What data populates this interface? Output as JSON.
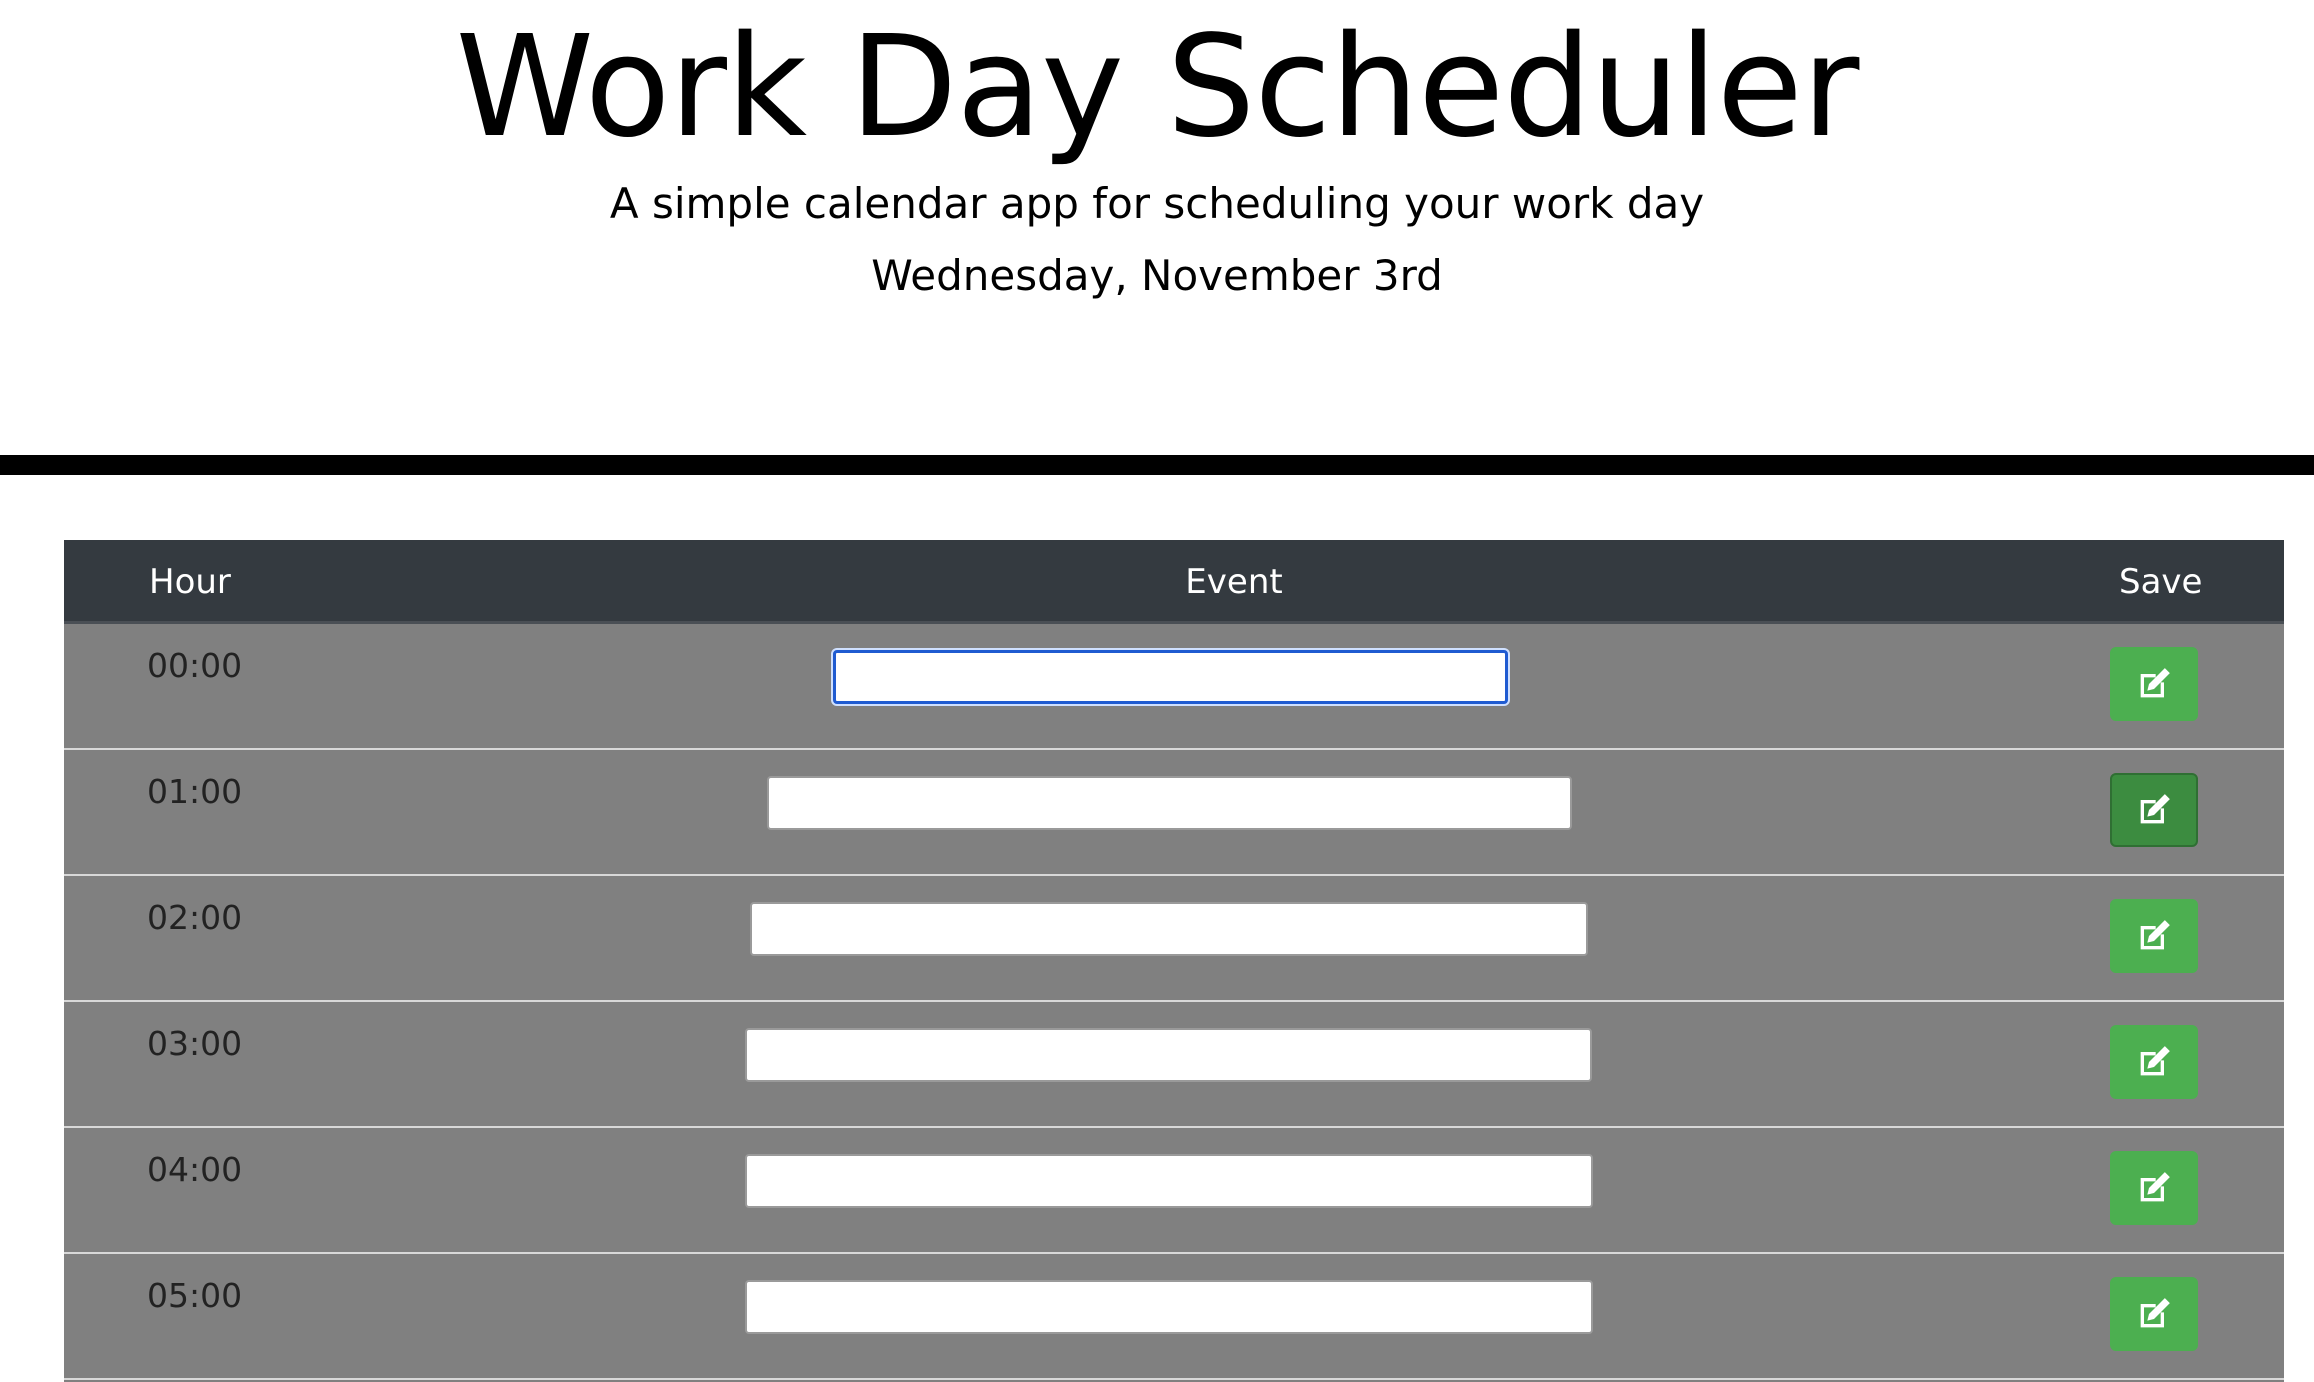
{
  "header": {
    "title": "Work Day Scheduler",
    "subtitle": "A simple calendar app for scheduling your work day",
    "date": "Wednesday, November 3rd"
  },
  "table": {
    "columns": {
      "hour": "Hour",
      "event": "Event",
      "save": "Save"
    },
    "rows": [
      {
        "hour": "00:00",
        "event": "",
        "save_icon": "edit-icon"
      },
      {
        "hour": "01:00",
        "event": "",
        "save_icon": "edit-icon"
      },
      {
        "hour": "02:00",
        "event": "",
        "save_icon": "edit-icon"
      },
      {
        "hour": "03:00",
        "event": "",
        "save_icon": "edit-icon"
      },
      {
        "hour": "04:00",
        "event": "",
        "save_icon": "edit-icon"
      },
      {
        "hour": "05:00",
        "event": "",
        "save_icon": "edit-icon"
      }
    ]
  },
  "colors": {
    "table_header": "#343a40",
    "row_background": "#808080",
    "save_button": "#4caf50",
    "save_button_hover": "#3c8c40",
    "focus_ring": "#1f5bd1"
  }
}
